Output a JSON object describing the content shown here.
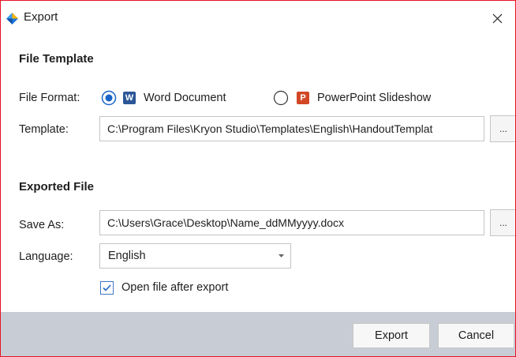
{
  "window": {
    "title": "Export",
    "logo_icon": "app-diamond-logo-icon",
    "close_icon": "close-icon"
  },
  "colors": {
    "accent": "#1a64c8",
    "word": "#2b5797",
    "powerpoint": "#d24726",
    "footer_bg": "#c8cdd5",
    "window_border": "#e81123"
  },
  "file_template": {
    "heading": "File Template",
    "format_label": "File Format:",
    "options": [
      {
        "icon_letter": "W",
        "label": "Word Document",
        "selected": true
      },
      {
        "icon_letter": "P",
        "label": "PowerPoint Slideshow",
        "selected": false
      }
    ],
    "template_label": "Template:",
    "template_value": "C:\\Program Files\\Kryon Studio\\Templates\\English\\HandoutTemplat",
    "browse_label": "..."
  },
  "exported_file": {
    "heading": "Exported File",
    "save_as_label": "Save As:",
    "save_as_value": "C:\\Users\\Grace\\Desktop\\Name_ddMMyyyy.docx",
    "browse_label": "...",
    "language_label": "Language:",
    "language_value": "English",
    "open_after_label": "Open file after export",
    "open_after_checked": true
  },
  "footer": {
    "export_label": "Export",
    "cancel_label": "Cancel"
  }
}
